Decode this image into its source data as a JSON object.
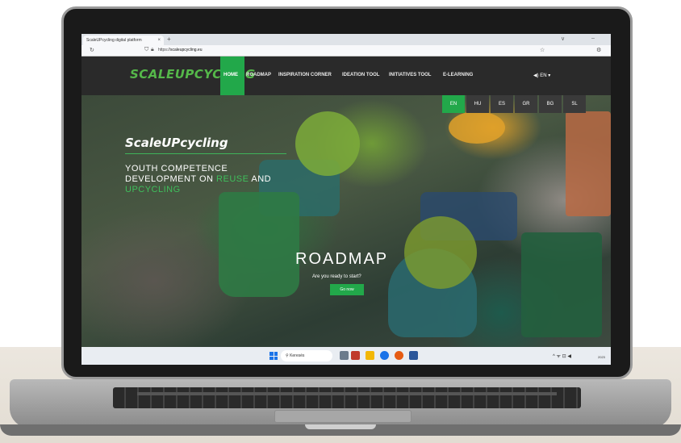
{
  "browser": {
    "tab_title": "ScaleUPcycling digital platform",
    "tab_close": "×",
    "new_tab": "+",
    "url_prefix": "https://",
    "url_host": "scaleupcycling.eu",
    "back_icon": "reload-icon",
    "window_minimize": "–",
    "window_chevron": "∨"
  },
  "site_nav": {
    "logo": "SCALEUPCYCLING",
    "items": [
      "HOME",
      "ROADMAP",
      "INSPIRATION CORNER",
      "IDEATION TOOL",
      "INITIATIVES TOOL",
      "E-LEARNING"
    ],
    "active_item": "HOME",
    "language_selector": "◀) EN ▾"
  },
  "languages": [
    "EN",
    "HU",
    "ES",
    "GR",
    "BG",
    "SL"
  ],
  "active_language": "EN",
  "hero": {
    "brand": "ScaleUPcycling",
    "tagline_line1": "YOUTH COMPETENCE",
    "tagline_line2_a": "DEVELOPMENT ON ",
    "tagline_line2_b": "REUSE",
    "tagline_line2_c": " AND",
    "tagline_line3": "UPCYCLING",
    "section_title": "ROADMAP",
    "section_subtitle": "Are you ready to start?",
    "cta_label": "Go now"
  },
  "taskbar": {
    "search_placeholder": "Keresés",
    "tray_text": "^  ᯤ  ⊡  ◀",
    "clock": "2023"
  },
  "colors": {
    "accent_green": "#22a84a",
    "logo_green": "#55b84a",
    "nav_bg": "#2a2a2a"
  }
}
